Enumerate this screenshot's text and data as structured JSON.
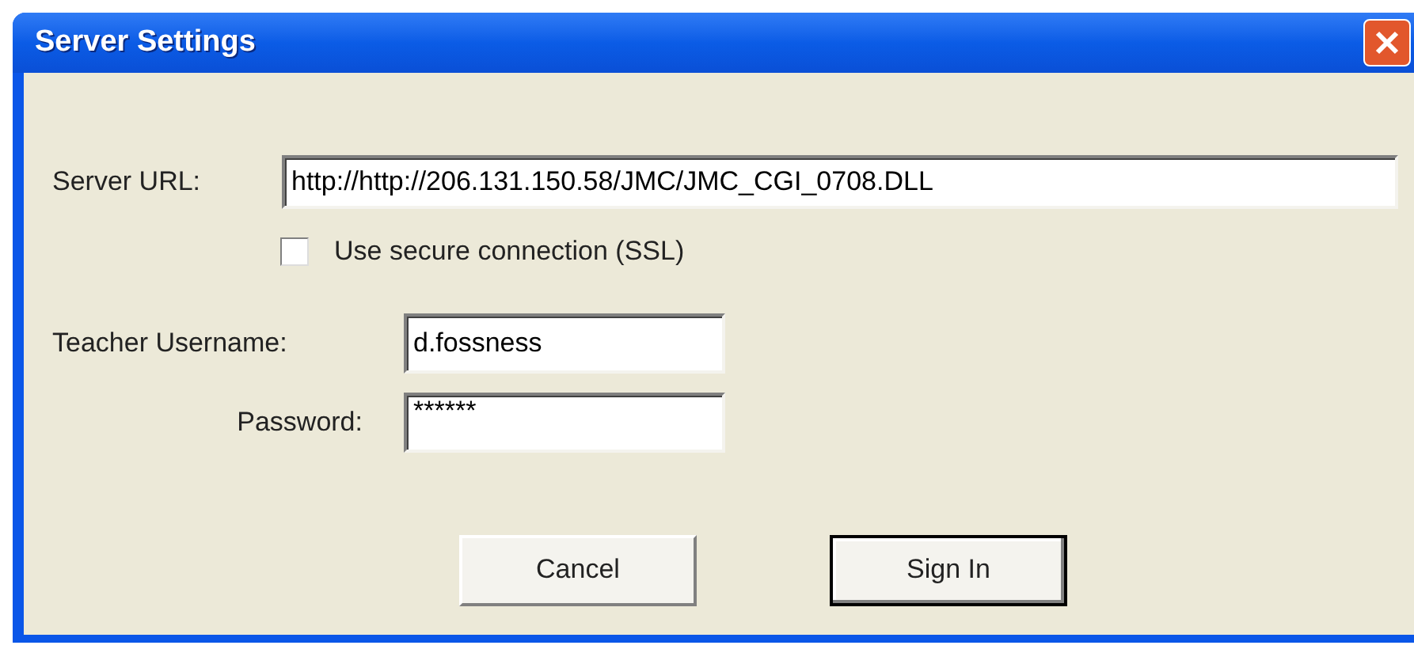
{
  "window": {
    "title": "Server Settings"
  },
  "server_url": {
    "label": "Server URL:",
    "value": "http://http://206.131.150.58/JMC/JMC_CGI_0708.DLL"
  },
  "ssl": {
    "label": "Use secure connection (SSL)",
    "checked": false
  },
  "username": {
    "label": "Teacher Username:",
    "value": "d.fossness"
  },
  "password": {
    "label": "Password:",
    "value": "******"
  },
  "buttons": [
    {
      "label": "Cancel",
      "default": false
    },
    {
      "label": "Sign In",
      "default": true
    }
  ]
}
